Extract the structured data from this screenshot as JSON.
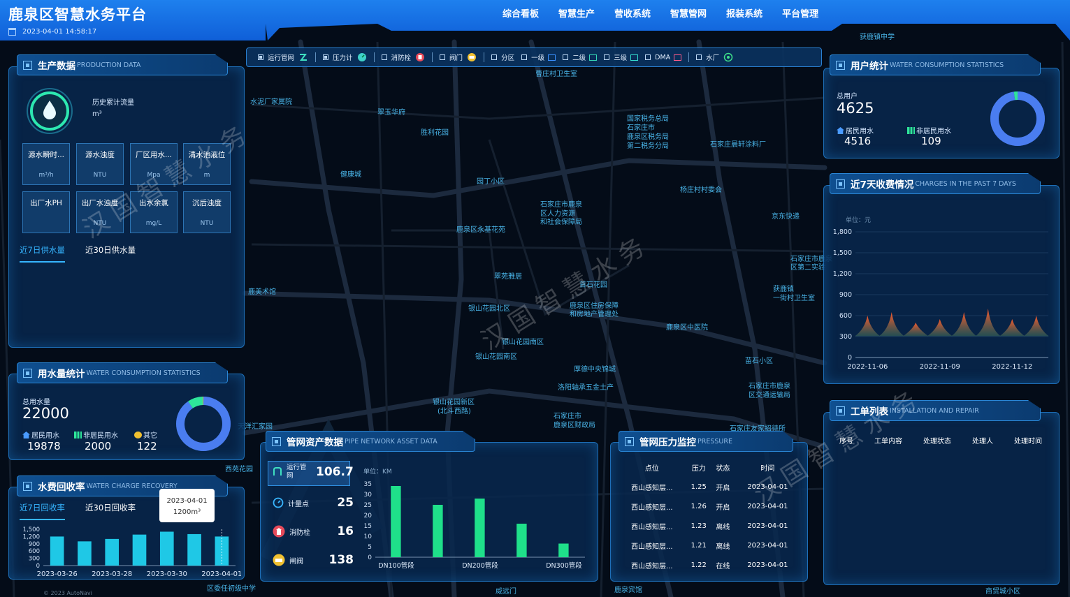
{
  "header": {
    "title": "鹿泉区智慧水务平台",
    "datetime": "2023-04-01 14:58:17",
    "nav": [
      "综合看板",
      "智慧生产",
      "营收系统",
      "智慧管网",
      "报装系统",
      "平台管理"
    ]
  },
  "toolbar": {
    "items": [
      {
        "label": "运行管网",
        "checked": true
      },
      {
        "label": "压力计",
        "checked": true
      },
      {
        "label": "消防栓",
        "checked": false
      },
      {
        "label": "阀门",
        "checked": false
      },
      {
        "label": "分区",
        "checked": false
      },
      {
        "label": "一级",
        "checked": false
      },
      {
        "label": "二级",
        "checked": false
      },
      {
        "label": "三级",
        "checked": false
      },
      {
        "label": "DMA",
        "checked": false
      },
      {
        "label": "水厂",
        "checked": false
      }
    ],
    "colors": {
      "level1": "#3a8fff",
      "level2": "#35d6b4",
      "level3": "#35e0d0",
      "dma": "#ff5c8a"
    }
  },
  "production": {
    "title_cn": "生产数据",
    "title_en": "PRODUCTION DATA",
    "history_label": "历史累计流量",
    "history_unit": "m³",
    "tiles": [
      {
        "name": "源水瞬时...",
        "unit": "m³/h"
      },
      {
        "name": "源水浊度",
        "unit": "NTU"
      },
      {
        "name": "厂区用水...",
        "unit": "Mpa"
      },
      {
        "name": "清水池液位",
        "unit": "m"
      },
      {
        "name": "出厂水PH",
        "unit": ""
      },
      {
        "name": "出厂水浊度",
        "unit": "NTU"
      },
      {
        "name": "出水余氯",
        "unit": "mg/L"
      },
      {
        "name": "沉后浊度",
        "unit": "NTU"
      }
    ],
    "tabs": [
      "近7日供水量",
      "近30日供水量"
    ]
  },
  "water_use": {
    "title_cn": "用水量统计",
    "title_en": "WATER CONSUMPTION STATISTICS",
    "total_label": "总用水量",
    "total": "22000",
    "items": [
      {
        "label": "居民用水",
        "value": "19878"
      },
      {
        "label": "非居民用水",
        "value": "2000"
      },
      {
        "label": "其它",
        "value": "122"
      }
    ],
    "donut": {
      "fractions": [
        0.9035,
        0.0909,
        0.0056
      ],
      "colors": [
        "#4a7df0",
        "#2ee59a",
        "#f0c030"
      ]
    }
  },
  "recovery": {
    "title_cn": "水费回收率",
    "title_en": "WATER CHARGE RECOVERY",
    "tabs": [
      "近7日回收率",
      "近30日回收率"
    ],
    "tooltip": {
      "date": "2023-04-01",
      "value": "1200m³"
    }
  },
  "chart_data": [
    {
      "type": "bar",
      "categories": [
        "2023-03-26",
        "2023-03-27",
        "2023-03-28",
        "2023-03-29",
        "2023-03-30",
        "2023-03-31",
        "2023-04-01"
      ],
      "values": [
        1200,
        1000,
        1100,
        1280,
        1400,
        1300,
        1200
      ],
      "x_ticks": [
        "2023-03-26",
        "2023-03-28",
        "2023-03-30",
        "2023-04-01"
      ],
      "y_ticks": [
        "1,500",
        "1,200",
        "900",
        "600",
        "300",
        "0"
      ],
      "ylim": [
        0,
        1500
      ],
      "color": "#1fc8e6"
    },
    {
      "type": "bar",
      "categories": [
        "DN100管段",
        "DN150管段",
        "DN200管段",
        "DN250管段",
        "DN300管段"
      ],
      "values": [
        34,
        25,
        28,
        16,
        6.5
      ],
      "x_ticks": [
        "DN100管段",
        "DN200管段",
        "DN300管段"
      ],
      "y_ticks": [
        "35",
        "30",
        "25",
        "20",
        "15",
        "10",
        "5",
        "0"
      ],
      "ylim": [
        0,
        35
      ],
      "unit": "单位：KM",
      "color": "#1fe08a"
    },
    {
      "type": "area",
      "x": [
        "2022-11-06",
        "2022-11-07",
        "2022-11-08",
        "2022-11-09",
        "2022-11-10",
        "2022-11-11",
        "2022-11-12",
        "2022-11-13"
      ],
      "values": [
        600,
        650,
        500,
        550,
        650,
        700,
        550,
        600
      ],
      "x_ticks": [
        "2022-11-06",
        "2022-11-09",
        "2022-11-12"
      ],
      "y_ticks": [
        "1,800",
        "1,500",
        "1,200",
        "900",
        "600",
        "300",
        "0"
      ],
      "ylim": [
        0,
        1800
      ],
      "unit": "单位：元"
    }
  ],
  "assets": {
    "title_cn": "管网资产数据",
    "title_en": "PIPE NETWORK ASSET DATA",
    "items": [
      {
        "label": "运行管网",
        "value": "106.7"
      },
      {
        "label": "计量点",
        "value": "25"
      },
      {
        "label": "消防栓",
        "value": "16"
      },
      {
        "label": "闸阀",
        "value": "138"
      }
    ]
  },
  "pressure": {
    "title_cn": "管网压力监控",
    "title_en": "PRESSURE",
    "headers": [
      "点位",
      "压力",
      "状态",
      "时间"
    ],
    "rows": [
      [
        "西山感知层...",
        "1.25",
        "开启",
        "2023-04-01"
      ],
      [
        "西山感知层...",
        "1.26",
        "开启",
        "2023-04-01"
      ],
      [
        "西山感知层...",
        "1.23",
        "离线",
        "2023-04-01"
      ],
      [
        "西山感知层...",
        "1.21",
        "离线",
        "2023-04-01"
      ],
      [
        "西山感知层...",
        "1.22",
        "在线",
        "2023-04-01"
      ]
    ]
  },
  "users": {
    "title_cn": "用户统计",
    "title_en": "WATER CONSUMPTION STATISTICS",
    "total_label": "总用户",
    "total": "4625",
    "items": [
      {
        "label": "居民用水",
        "value": "4516"
      },
      {
        "label": "非居民用水",
        "value": "109"
      }
    ],
    "donut": {
      "fractions": [
        0.9764,
        0.0236
      ],
      "colors": [
        "#4a7df0",
        "#2ee59a"
      ]
    }
  },
  "charges": {
    "title_cn": "近7天收费情况",
    "title_en": "CHARGES IN THE PAST 7 DAYS"
  },
  "workorders": {
    "title_cn": "工单列表",
    "title_en": "INSTALLATION AND REPAIR",
    "headers": [
      "序号",
      "工单内容",
      "处理状态",
      "处理人",
      "处理时间"
    ]
  },
  "watermark": "汉国智慧水务",
  "map": {
    "labels": [
      "水泥厂家属院",
      "翠玉华府",
      "胜利花园",
      "健康城",
      "园丁小区",
      "国家税务总局",
      "石家庄市",
      "鹿泉区税务局",
      "第二税务分局",
      "石家庄晨轩涂料厂",
      "石家庄市鹿泉",
      "区人力资源",
      "和社会保障局",
      "杨庄村村委会",
      "鹿泉区永基花苑",
      "京东快递",
      "翠苑雅居",
      "首石花园",
      "银山花园北区",
      "鹿泉区住房保障",
      "和房地产管理处",
      "鹿泉区中医院",
      "银山花园南区",
      "银山花园南区",
      "厚德中央锦城",
      "洛阳轴承五金土产",
      "银山花园新区",
      "(北斗西路)",
      "石家庄市",
      "鹿泉区财政局",
      "苗石小区",
      "石家庄市鹿泉",
      "区交通运输局",
      "石家庄友家招待所",
      "获鹿镇",
      "一街村卫生室",
      "石家庄市鹿泉",
      "区第二实验",
      "鹿美术馆",
      "曹庄村卫生室",
      "获鹿镇中学",
      "西苑花园",
      "天洋汇家园",
      "威远门",
      "鹿泉宾馆",
      "商贸城小区",
      "© 2023 AutoNavi",
      "区委任初级中学"
    ]
  }
}
